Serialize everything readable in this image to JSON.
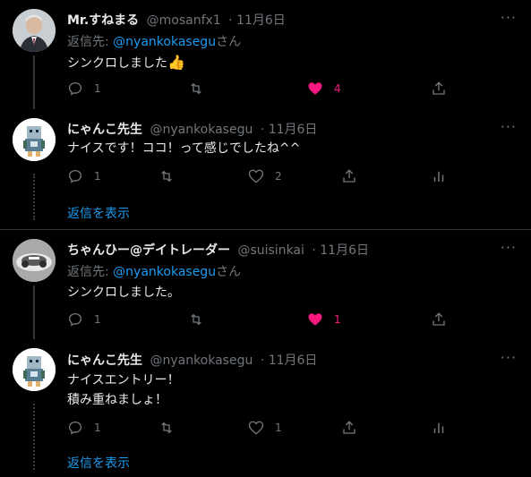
{
  "colors": {
    "background": "#000000",
    "text": "#e7e9ea",
    "secondary": "#71767b",
    "link": "#1d9bf0",
    "like": "#f91880",
    "divider": "#2f3336"
  },
  "tweets": [
    {
      "name": "Mr.すねまる",
      "handle": "@mosanfx1",
      "date": "· 11月6日",
      "reply_prefix": "返信先: ",
      "reply_mention": "@nyankokasegu",
      "reply_suffix": "さん",
      "text": "シンクロしました",
      "emoji": "👍",
      "reply_count": "1",
      "like_count": "4",
      "liked": true
    },
    {
      "name": "にゃんこ先生",
      "handle": "@nyankokasegu",
      "date": "· 11月6日",
      "text": "ナイスです！ココ！って感じでしたね^^",
      "reply_count": "1",
      "like_count": "2",
      "show_replies": "返信を表示"
    },
    {
      "name": "ちゃんひー@デイトレーダー",
      "handle": "@suisinkai",
      "date": "· 11月6日",
      "reply_prefix": "返信先: ",
      "reply_mention": "@nyankokasegu",
      "reply_suffix": "さん",
      "text": "シンクロしました。",
      "reply_count": "1",
      "like_count": "1",
      "liked": true
    },
    {
      "name": "にゃんこ先生",
      "handle": "@nyankokasegu",
      "date": "· 11月6日",
      "text_line1": "ナイスエントリー！",
      "text_line2": "積み重ねましょ！",
      "reply_count": "1",
      "like_count": "1",
      "show_replies": "返信を表示"
    }
  ],
  "icons": {
    "more": "more-icon",
    "reply": "reply-icon",
    "retweet": "retweet-icon",
    "like": "heart-icon",
    "share": "share-icon",
    "analytics": "analytics-icon"
  }
}
